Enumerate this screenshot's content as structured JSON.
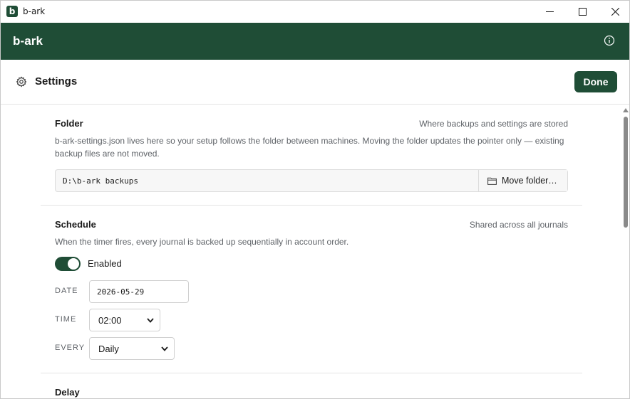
{
  "window": {
    "title": "b-ark",
    "icon_letter": "b"
  },
  "header": {
    "brand": "b-ark"
  },
  "settings": {
    "title": "Settings",
    "done_label": "Done"
  },
  "folder": {
    "title": "Folder",
    "hint": "Where backups and settings are stored",
    "description": "b-ark-settings.json lives here so your setup follows the folder between machines. Moving the folder updates the pointer only — existing backup files are not moved.",
    "path": "D:\\b-ark backups",
    "move_label": "Move folder…"
  },
  "schedule": {
    "title": "Schedule",
    "hint": "Shared across all journals",
    "description": "When the timer fires, every journal is backed up sequentially in account order.",
    "enabled_label": "Enabled",
    "enabled": true,
    "date_label": "DATE",
    "date_value": "2026-05-29",
    "time_label": "TIME",
    "time_value": "02:00",
    "every_label": "EVERY",
    "every_value": "Daily"
  },
  "delay": {
    "title": "Delay"
  },
  "colors": {
    "accent": "#1f4d36",
    "muted_text": "#5f6368",
    "divider": "#e4e4e4"
  },
  "icons": [
    "app-icon",
    "minimize-icon",
    "maximize-icon",
    "close-icon",
    "info-icon",
    "gear-icon",
    "folder-icon",
    "chevron-down-icon",
    "scroll-up-arrow"
  ]
}
